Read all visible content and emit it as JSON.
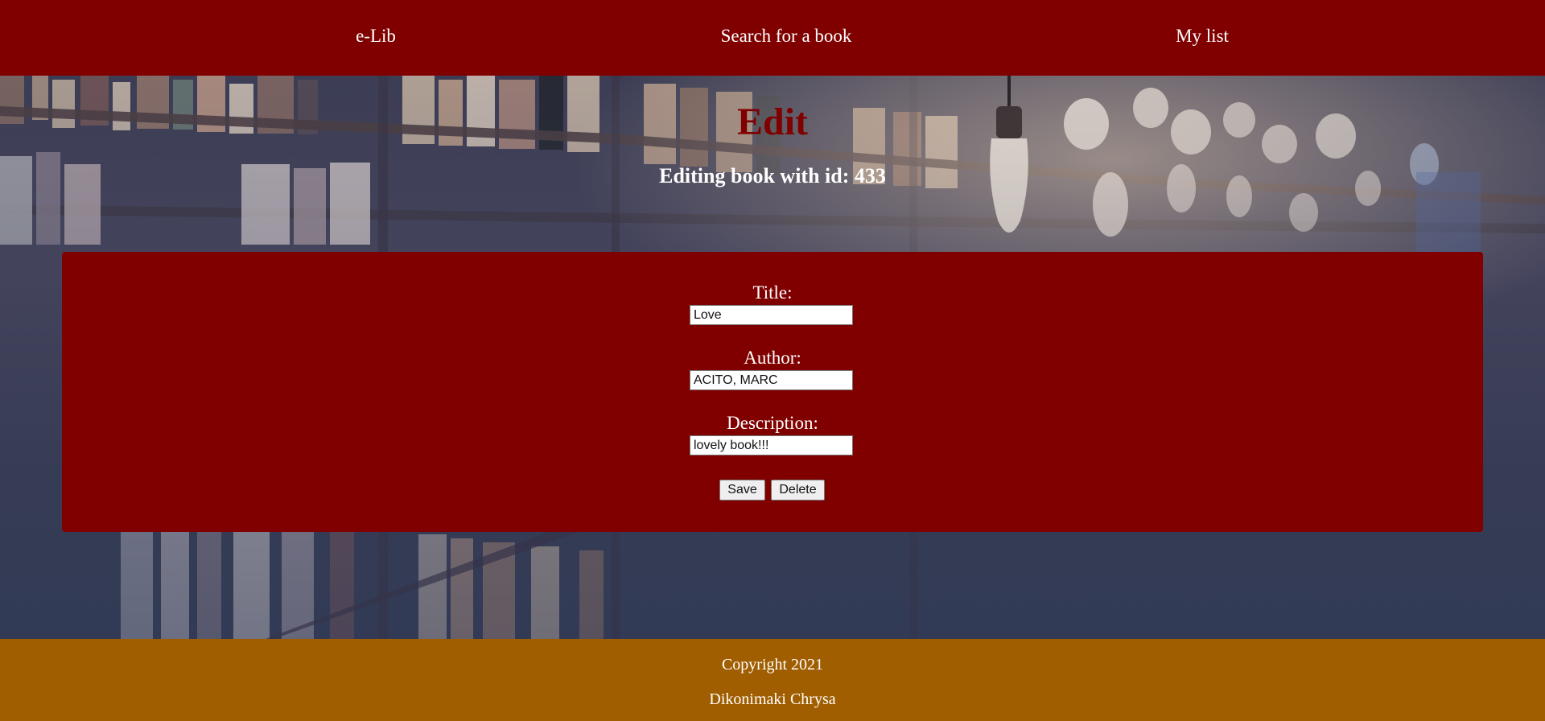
{
  "nav": {
    "brand": "e-Lib",
    "search": "Search for a book",
    "my_list": "My list"
  },
  "main": {
    "title": "Edit",
    "subtitle": "Editing book with id: 433"
  },
  "form": {
    "title_label": "Title:",
    "title_value": "Love",
    "author_label": "Author:",
    "author_value": "ACITO, MARC",
    "description_label": "Description:",
    "description_value": "lovely book!!!",
    "save_label": "Save",
    "delete_label": "Delete"
  },
  "footer": {
    "copyright": "Copyright 2021",
    "author": "Dikonimaki Chrysa"
  },
  "colors": {
    "primary": "#800000",
    "footer": "#a05e00",
    "text_light": "#ffffff"
  }
}
